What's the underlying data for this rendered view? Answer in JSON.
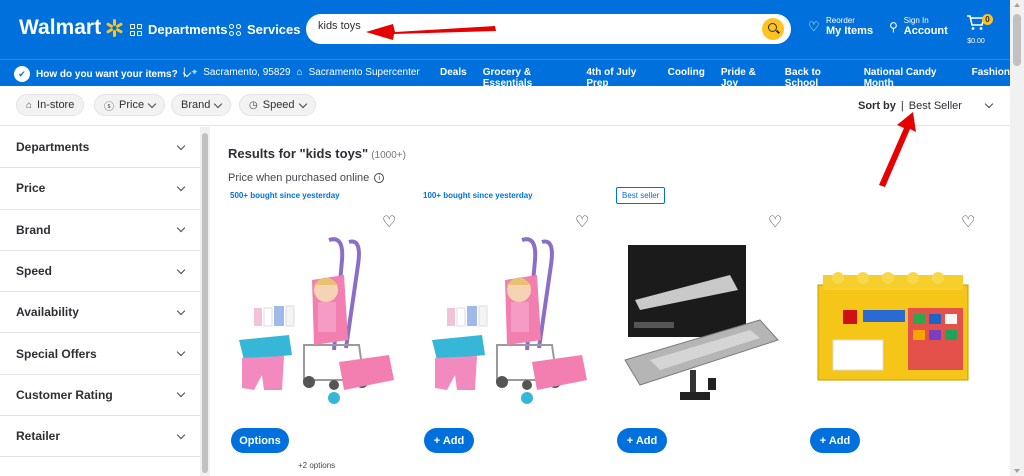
{
  "header": {
    "logo_text": "Walmart",
    "departments_label": "Departments",
    "services_label": "Services",
    "search_value": "kids toys",
    "reorder_small": "Reorder",
    "reorder_big": "My Items",
    "signin_small": "Sign In",
    "signin_big": "Account",
    "cart_count": "0",
    "cart_total": "$0.00"
  },
  "subbar": {
    "question": "How do you want your items?",
    "location": "Sacramento, 95829",
    "store": "Sacramento Supercenter",
    "links": [
      "Deals",
      "Grocery & Essentials",
      "4th of July Prep",
      "Cooling",
      "Pride & Joy",
      "Back to School",
      "National Candy Month",
      "Fashion"
    ]
  },
  "filters": {
    "chips": [
      "In-store",
      "Price",
      "Brand",
      "Speed"
    ],
    "sort_label": "Sort by",
    "sort_value": "Best Seller"
  },
  "sidebar": {
    "facets": [
      "Departments",
      "Price",
      "Brand",
      "Speed",
      "Availability",
      "Special Offers",
      "Customer Rating",
      "Retailer"
    ]
  },
  "results": {
    "title": "Results for \"kids toys\"",
    "count": "(1000+)",
    "price_note": "Price when purchased online"
  },
  "products": [
    {
      "tag": "500+ bought since yesterday",
      "button": "Options",
      "extra": "+2 options"
    },
    {
      "tag": "100+ bought since yesterday",
      "button": "+ Add"
    },
    {
      "tag": "Best seller",
      "button": "+ Add"
    },
    {
      "button": "+ Add"
    }
  ],
  "colors": {
    "brand_blue": "#0071dc",
    "spark_yellow": "#ffc220",
    "annotation_red": "#e60000"
  }
}
